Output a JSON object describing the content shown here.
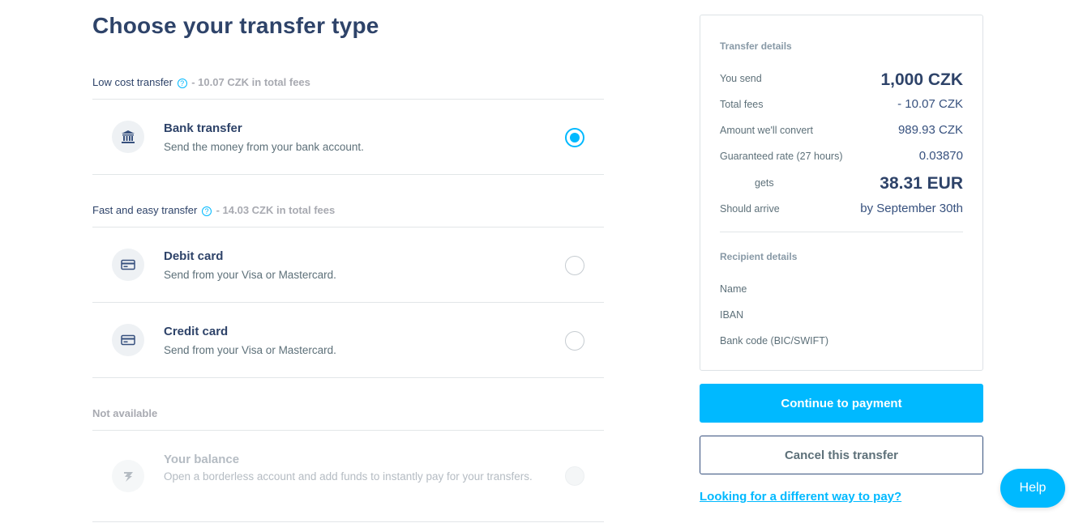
{
  "page": {
    "title": "Choose your transfer type"
  },
  "groups": {
    "low_cost": {
      "label": "Low cost transfer",
      "help_glyph": "?",
      "fees": " - 10.07 CZK in total fees"
    },
    "fast_easy": {
      "label": "Fast and easy transfer",
      "help_glyph": "?",
      "fees": " - 14.03 CZK in total fees"
    },
    "not_available": {
      "label": "Not available"
    }
  },
  "options": [
    {
      "title": "Bank transfer",
      "description": "Send the money from your bank account.",
      "icon": "bank-icon",
      "selected": true,
      "enabled": true
    },
    {
      "title": "Debit card",
      "description": "Send from your Visa or Mastercard.",
      "icon": "card-icon",
      "selected": false,
      "enabled": true
    },
    {
      "title": "Credit card",
      "description": "Send from your Visa or Mastercard.",
      "icon": "card-icon",
      "selected": false,
      "enabled": true
    },
    {
      "title": "Your balance",
      "description": "Open a borderless account and add funds to instantly pay for your transfers.",
      "icon": "wise-flag-icon",
      "selected": false,
      "enabled": false
    }
  ],
  "transfer_details": {
    "heading": "Transfer details",
    "you_send_label": "You send",
    "you_send_value": "1,000 CZK",
    "total_fees_label": "Total fees",
    "total_fees_value": "- 10.07 CZK",
    "amount_convert_label": "Amount we'll convert",
    "amount_convert_value": "989.93 CZK",
    "rate_label": "Guaranteed rate (27 hours)",
    "rate_value": "0.03870",
    "gets_label": "gets",
    "gets_value": "38.31 EUR",
    "arrive_label": "Should arrive",
    "arrive_value": "by September 30th"
  },
  "recipient_details": {
    "heading": "Recipient details",
    "name_label": "Name",
    "iban_label": "IBAN",
    "bank_code_label": "Bank code (BIC/SWIFT)"
  },
  "actions": {
    "continue_label": "Continue to payment",
    "cancel_label": "Cancel this transfer",
    "alt_link_label": "Looking for a different way to pay?",
    "help_label": "Help"
  },
  "colors": {
    "accent": "#00b9ff",
    "title": "#2e4369",
    "muted": "#a8aab1"
  }
}
